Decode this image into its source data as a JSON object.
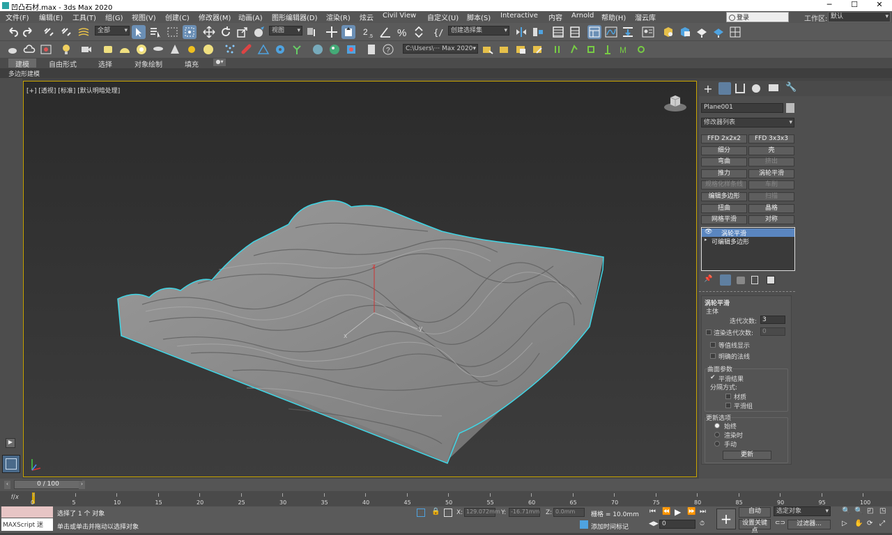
{
  "window": {
    "title": "凹凸石材.max - 3ds Max 2020",
    "controls": [
      "─",
      "☐",
      "✕"
    ]
  },
  "menu": [
    "文件(F)",
    "编辑(E)",
    "工具(T)",
    "组(G)",
    "视图(V)",
    "创建(C)",
    "修改器(M)",
    "动画(A)",
    "图形编辑器(D)",
    "渲染(R)",
    "炫云",
    "Civil View",
    "自定义(U)",
    "脚本(S)",
    "Interactive",
    "内容",
    "Arnold",
    "帮助(H)",
    "溜云库"
  ],
  "login": "登录",
  "workspace_label": "工作区:",
  "workspace": "默认",
  "toolbar": {
    "selection_filter": "全部",
    "ref_coord": "视图",
    "named_selection": "创建选择集",
    "project_path": "C:\\Users\\··· Max 2020"
  },
  "ribbon": {
    "tabs": [
      "建模",
      "自由形式",
      "选择",
      "对象绘制",
      "填充"
    ],
    "sub": "多边形建模"
  },
  "viewport": {
    "label": "[+] [透视] [标准] [默认明暗处理]",
    "axis_x": "x",
    "axis_y": "y",
    "axis_z": "z"
  },
  "command": {
    "object_name": "Plane001",
    "modifier_list": "修改器列表",
    "buttons": [
      [
        "FFD 2x2x2",
        false
      ],
      [
        "FFD 3x3x3",
        false
      ],
      [
        "细分",
        false
      ],
      [
        "壳",
        false
      ],
      [
        "弯曲",
        false
      ],
      [
        "挤出",
        true
      ],
      [
        "推力",
        false
      ],
      [
        "涡轮平滑",
        false
      ],
      [
        "规格化样条线",
        true
      ],
      [
        "车削",
        true
      ],
      [
        "编辑多边形",
        false
      ],
      [
        "扫描",
        true
      ],
      [
        "扭曲",
        false
      ],
      [
        "晶格",
        false
      ],
      [
        "网格平滑",
        false
      ],
      [
        "对称",
        false
      ]
    ],
    "stack": [
      "涡轮平滑",
      "可编辑多边形"
    ],
    "rollout_title": "涡轮平滑",
    "main_label": "主体",
    "iterations_label": "迭代次数:",
    "iterations": "3",
    "render_iters_label": "渲染迭代次数:",
    "render_iters": "0",
    "isoline": "等值线显示",
    "explicit": "明确的法线",
    "surface_label": "曲面参数",
    "smooth_result": "平滑结果",
    "separate_label": "分隔方式:",
    "by_material": "材质",
    "by_smoothing": "平滑组",
    "update_label": "更新选项",
    "always": "始终",
    "on_render": "渲染时",
    "manual": "手动",
    "update_btn": "更新"
  },
  "timeline": {
    "frame": "0 / 100",
    "ticks": [
      "0",
      "5",
      "10",
      "15",
      "20",
      "25",
      "30",
      "35",
      "40",
      "45",
      "50",
      "55",
      "60",
      "65",
      "70",
      "75",
      "80",
      "85",
      "90",
      "95",
      "100"
    ]
  },
  "status": {
    "maxscript": "MAXScript 迷",
    "selected": "选择了 1 个 对象",
    "hint": "单击或单击并拖动以选择对象",
    "x_label": "X:",
    "x": "129.072mm",
    "y_label": "Y:",
    "y": "-16.71mm",
    "z_label": "Z:",
    "z": "0.0mm",
    "grid": "栅格 = 10.0mm",
    "add_time_tag": "添加时间标记",
    "auto": "自动",
    "set_key": "设置关键点",
    "selected_obj": "选定对象",
    "filters": "过滤器...",
    "frame_input": "0"
  }
}
